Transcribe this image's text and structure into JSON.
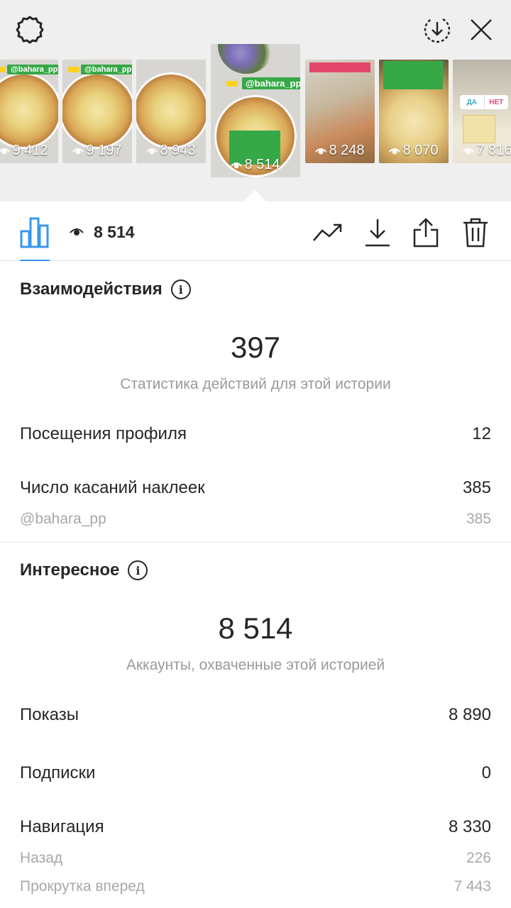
{
  "stories": [
    {
      "views": "9 412",
      "tag": "@bahara_pp",
      "theme": "pizza"
    },
    {
      "views": "9 197",
      "tag": "@bahara_pp",
      "theme": "pizza"
    },
    {
      "views": "8 943",
      "tag": "",
      "theme": "pizza"
    },
    {
      "views": "8 514",
      "tag": "@bahara_pp",
      "theme": "pizza",
      "selected": true
    },
    {
      "views": "8 248",
      "tag": "",
      "theme": "hand"
    },
    {
      "views": "8 070",
      "tag": "",
      "theme": "cheese"
    },
    {
      "views": "7 816",
      "tag": "",
      "theme": "poll",
      "poll_yes": "ДА",
      "poll_no": "НЕТ"
    }
  ],
  "toolbar": {
    "views_count": "8 514"
  },
  "interactions": {
    "title": "Взаимодействия",
    "total": "397",
    "caption": "Статистика действий для этой истории",
    "rows": [
      {
        "label": "Посещения профиля",
        "value": "12"
      },
      {
        "label": "Число касаний наклеек",
        "value": "385"
      }
    ],
    "sub_rows": [
      {
        "label": "@bahara_pp",
        "value": "385"
      }
    ]
  },
  "discovery": {
    "title": "Интересное",
    "total": "8 514",
    "caption": "Аккаунты, охваченные этой историей",
    "rows": [
      {
        "label": "Показы",
        "value": "8 890"
      },
      {
        "label": "Подписки",
        "value": "0"
      },
      {
        "label": "Навигация",
        "value": "8 330"
      }
    ],
    "sub_rows": [
      {
        "label": "Назад",
        "value": "226"
      },
      {
        "label": "Прокрутка вперед",
        "value": "7 443"
      }
    ]
  },
  "colors": {
    "accent": "#3897f0",
    "tag_green": "#37a847",
    "muted_text": "#9a9a9a"
  }
}
